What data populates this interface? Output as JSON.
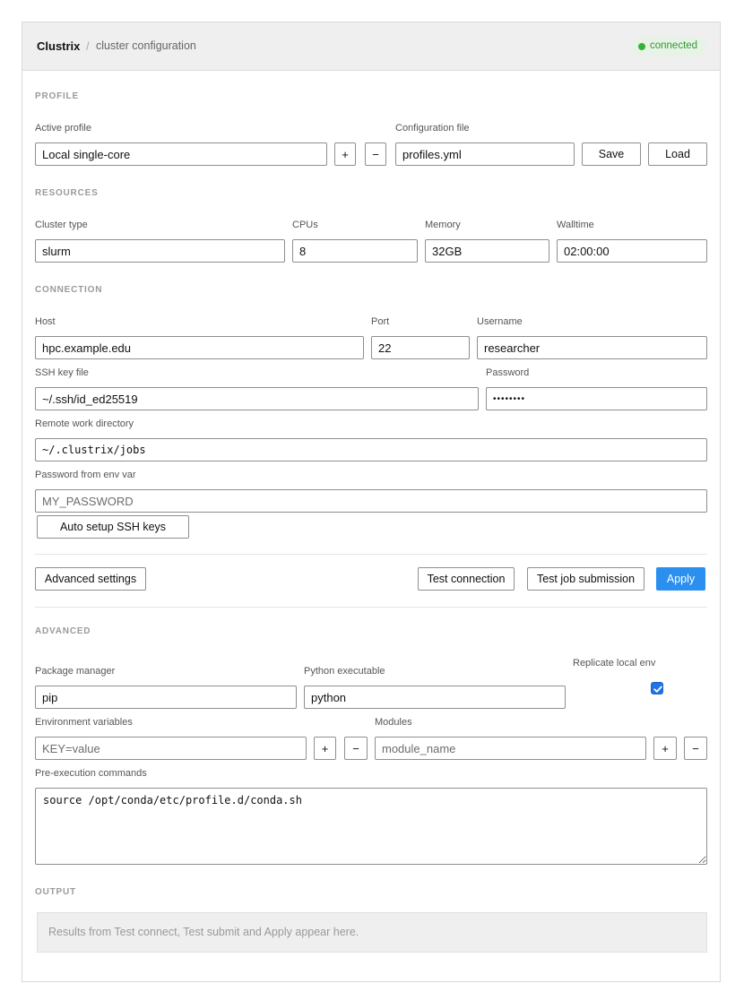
{
  "header": {
    "brand": "Clustrix",
    "separator": "/",
    "subtitle": "cluster configuration",
    "status": "connected",
    "status_color": "#35b135"
  },
  "profile": {
    "section": "PROFILE",
    "active_label": "Active profile",
    "active_value": "Local single-core",
    "add": "+",
    "remove": "−",
    "config_label": "Configuration file",
    "config_value": "profiles.yml",
    "save": "Save",
    "load": "Load"
  },
  "resources": {
    "section": "RESOURCES",
    "cluster_type_label": "Cluster type",
    "cluster_type_value": "slurm",
    "cpus_label": "CPUs",
    "cpus_value": "8",
    "memory_label": "Memory",
    "memory_value": "32GB",
    "walltime_label": "Walltime",
    "walltime_value": "02:00:00"
  },
  "connection": {
    "section": "CONNECTION",
    "host_label": "Host",
    "host_value": "hpc.example.edu",
    "port_label": "Port",
    "port_value": "22",
    "username_label": "Username",
    "username_value": "researcher",
    "sshkey_label": "SSH key file",
    "sshkey_value": "~/.ssh/id_ed25519",
    "password_label": "Password",
    "password_value": "••••••••",
    "workdir_label": "Remote work directory",
    "workdir_value": "~/.clustrix/jobs",
    "envpass_label": "Password from env var",
    "envpass_placeholder": "MY_PASSWORD",
    "auto_setup": "Auto setup SSH keys"
  },
  "actions": {
    "advanced": "Advanced settings",
    "test_connection": "Test connection",
    "test_job": "Test job submission",
    "apply": "Apply",
    "accent": "#2b8ff0"
  },
  "advanced": {
    "section": "ADVANCED",
    "pkg_label": "Package manager",
    "pkg_value": "pip",
    "python_label": "Python executable",
    "python_value": "python",
    "replicate_label": "Replicate local env",
    "replicate_checked": true,
    "env_label": "Environment variables",
    "env_placeholder": "KEY=value",
    "modules_label": "Modules",
    "modules_placeholder": "module_name",
    "add": "+",
    "remove": "−",
    "preexec_label": "Pre-execution commands",
    "preexec_value": "source /opt/conda/etc/profile.d/conda.sh"
  },
  "output": {
    "section": "OUTPUT",
    "placeholder": "Results from Test connect, Test submit and Apply appear here."
  }
}
